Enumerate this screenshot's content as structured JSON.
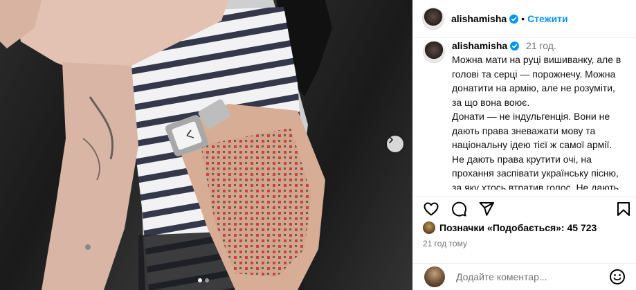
{
  "header": {
    "username": "alishamisha",
    "separator": "•",
    "follow_label": "Стежити"
  },
  "caption": {
    "username": "alishamisha",
    "time_ago": "21 год.",
    "lines": [
      "Можна мати на руці вишиванку, але в голові та серці — порожнечу. Можна донатити на армію, але не розуміти, за що вона воює.",
      "Донати — не індульгенція. Вони не дають права зневажати мову та національну ідею тієї ж самої армії. Не дають права крутити очі, на прохання заспівати українську пісню, за яку хтось втратив голос. Не дають права плювати на те,"
    ]
  },
  "actions": {
    "like_icon": "heart-icon",
    "comment_icon": "comment-icon",
    "share_icon": "share-icon",
    "save_icon": "bookmark-icon"
  },
  "likes": {
    "label": "Позначки «Подобається»: 45 723"
  },
  "post_age": "21 год тому",
  "comment": {
    "placeholder": "Додайте коментар..."
  },
  "media": {
    "next_icon": "chevron-right-icon",
    "slide_count": 2,
    "active_slide": 1
  },
  "colors": {
    "accent": "#0095f6",
    "verified": "#0095f6",
    "muted": "#737373"
  }
}
